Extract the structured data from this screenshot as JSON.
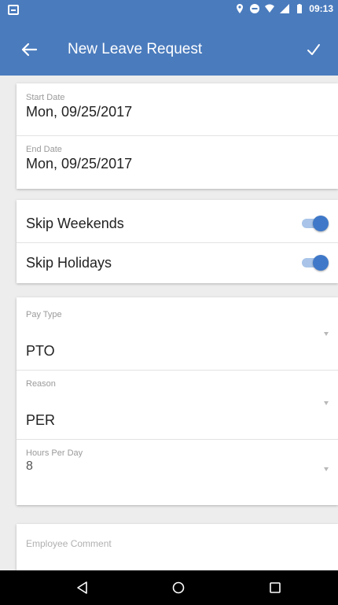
{
  "status_bar": {
    "time": "09:13"
  },
  "app_bar": {
    "title": "New Leave Request"
  },
  "dates": {
    "start_label": "Start Date",
    "start_value": "Mon, 09/25/2017",
    "end_label": "End Date",
    "end_value": "Mon, 09/25/2017"
  },
  "skip": {
    "weekends_label": "Skip Weekends",
    "weekends_on": true,
    "holidays_label": "Skip Holidays",
    "holidays_on": true
  },
  "details": {
    "pay_type_label": "Pay Type",
    "pay_type_value": "PTO",
    "reason_label": "Reason",
    "reason_value": "PER",
    "hours_label": "Hours Per Day",
    "hours_value": "8"
  },
  "comment": {
    "placeholder": "Employee Comment"
  },
  "colors": {
    "primary": "#4a7bbd",
    "toggle_on": "#3f78c8"
  }
}
